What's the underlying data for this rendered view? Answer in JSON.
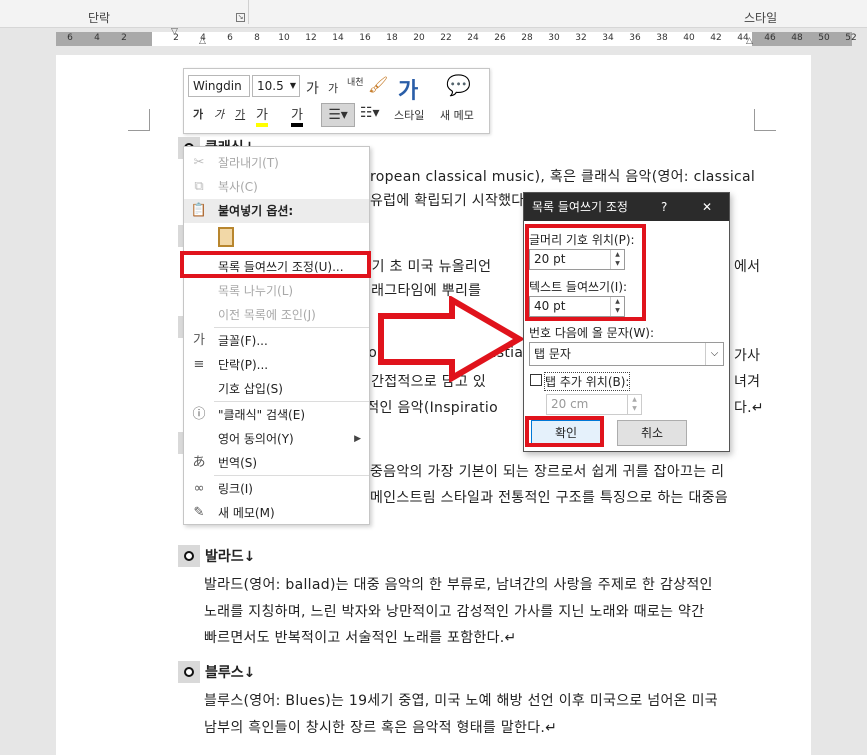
{
  "ribbon": {
    "paragraph_group": "단락",
    "styles_group": "스타일"
  },
  "ruler": {
    "numbers": [
      "6",
      "4",
      "2",
      "2",
      "4",
      "6",
      "8",
      "10",
      "12",
      "14",
      "16",
      "18",
      "20",
      "22",
      "24",
      "26",
      "28",
      "30",
      "32",
      "34",
      "36",
      "38",
      "40",
      "42",
      "44",
      "46",
      "48",
      "50",
      "52"
    ]
  },
  "mini_toolbar": {
    "font_name": "Wingdin",
    "font_size": "10.5",
    "grow_font": "가",
    "shrink_font": "가",
    "hanja": "내천",
    "bold": "가",
    "italic": "가",
    "underline": "가",
    "highlight": "가",
    "font_color": "가",
    "styles_icon": "가",
    "styles_label": "스타일",
    "new_comment_label": "새 메모"
  },
  "document": {
    "lines": [
      {
        "text": "ropean classical music), 혹은 클래식 음악(영어: classical"
      },
      {
        "text": "유럽에 확립되기 시작했다"
      },
      {
        "text": "20세기 초 미국 뉴올리언",
        "right": "에서"
      },
      {
        "text": "스와 래그타임에 뿌리를"
      },
      {
        "text": "M(Contemporary Christian",
        "right": "가사"
      },
      {
        "text": "또는 간접적으로 담고 있",
        "right": "녀겨"
      },
      {
        "text": "영감적인 음악(Inspiratio",
        "right": "다.↵"
      },
      {
        "text": "중음악의 가장 기본이 되는 장르로서 쉽게 귀를 잡아끄는 리"
      },
      {
        "text": "메인스트림 스타일과 전통적인 구조를 특징으로 하는 대중음"
      }
    ],
    "heading_clipped": "클래식↓",
    "sections": [
      {
        "title": "발라드↓",
        "lines": [
          "발라드(영어: ballad)는 대중 음악의 한 부류로, 남녀간의 사랑을 주제로 한 감상적인",
          "노래를 지칭하며, 느린 박자와 낭만적이고 감성적인 가사를 지닌 노래와 때로는 약간",
          "빠르면서도 반복적이고 서술적인 노래를 포함한다.↵"
        ]
      },
      {
        "title": "블루스↓",
        "lines": [
          "블루스(영어: Blues)는 19세기 중엽, 미국 노예 해방 선언 이후 미국으로 넘어온 미국",
          "남부의 흑인들이 창시한 장르 혹은 음악적 형태를 말한다.↵"
        ]
      }
    ]
  },
  "context_menu": {
    "items": [
      {
        "label": "잘라내기(T)",
        "icon": "scissors-icon",
        "glyph": "✂",
        "disabled": true
      },
      {
        "label": "복사(C)",
        "icon": "copy-icon",
        "glyph": "⧉",
        "disabled": true
      },
      {
        "label": "붙여넣기 옵션:",
        "icon": "paste-icon",
        "glyph": "📋",
        "disabled": false,
        "header": true
      },
      {
        "label": "목록 들여쓰기 조정(U)...",
        "icon": "",
        "glyph": "",
        "disabled": false,
        "highlight": true
      },
      {
        "label": "목록 나누기(L)",
        "icon": "",
        "glyph": "",
        "disabled": true
      },
      {
        "label": "이전 목록에 조인(J)",
        "icon": "",
        "glyph": "",
        "disabled": true
      },
      {
        "label": "글꼴(F)...",
        "icon": "font-icon",
        "glyph": "가",
        "disabled": false
      },
      {
        "label": "단락(P)...",
        "icon": "paragraph-icon",
        "glyph": "≡",
        "disabled": false
      },
      {
        "label": "기호 삽입(S)",
        "icon": "",
        "glyph": "",
        "disabled": false
      },
      {
        "label": "\"클래식\" 검색(E)",
        "icon": "search-icon",
        "glyph": "ⓘ",
        "disabled": false
      },
      {
        "label": "영어 동의어(Y)",
        "icon": "",
        "glyph": "",
        "disabled": false,
        "submenu": true
      },
      {
        "label": "번역(S)",
        "icon": "translate-icon",
        "glyph": "あ",
        "disabled": false
      },
      {
        "label": "링크(I)",
        "icon": "link-icon",
        "glyph": "∞",
        "disabled": false
      },
      {
        "label": "새 메모(M)",
        "icon": "comment-icon",
        "glyph": "✎",
        "disabled": false
      }
    ]
  },
  "dialog": {
    "title": "목록 들여쓰기 조정",
    "help": "?",
    "close": "✕",
    "bullet_position_label": "글머리 기호 위치(P):",
    "bullet_position_value": "20 pt",
    "text_indent_label": "텍스트 들여쓰기(I):",
    "text_indent_value": "40 pt",
    "follow_label": "번호 다음에 올 문자(W):",
    "follow_value": "탭 문자",
    "add_tab_label": "탭 추가 위치(B):",
    "add_tab_checked": false,
    "tab_value": "20 cm",
    "ok": "확인",
    "cancel": "취소"
  },
  "colors": {
    "highlight_red": "#e0131c",
    "dialog_title_bg": "#2b2b2b"
  }
}
